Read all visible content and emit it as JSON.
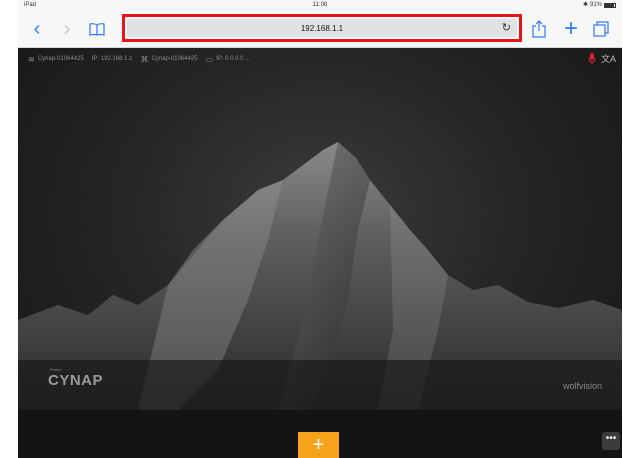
{
  "status_bar": {
    "device": "iPad",
    "time": "11:08",
    "battery": "91%"
  },
  "browser": {
    "address": "192.168.1.1",
    "icons": [
      "back-icon",
      "forward-icon",
      "bookmarks-icon",
      "reload-icon",
      "share-icon",
      "new-tab-icon",
      "tabs-icon"
    ]
  },
  "cynap": {
    "info_bar": {
      "wifi_name": "Cynap-01064425",
      "ip": "IP: 192.168.1.1",
      "lan_name": "Cynap-01064425",
      "lan_ip": "IP: 0.0.0.0 ..."
    },
    "brand_small": "Pureo",
    "brand": "CYNAP",
    "vendor": "wolfvision",
    "add_label": "+",
    "more_label": "•••"
  },
  "colors": {
    "highlight": "#e8141b",
    "accent": "#f7a21b",
    "ios_blue": "#2f7cf6"
  }
}
